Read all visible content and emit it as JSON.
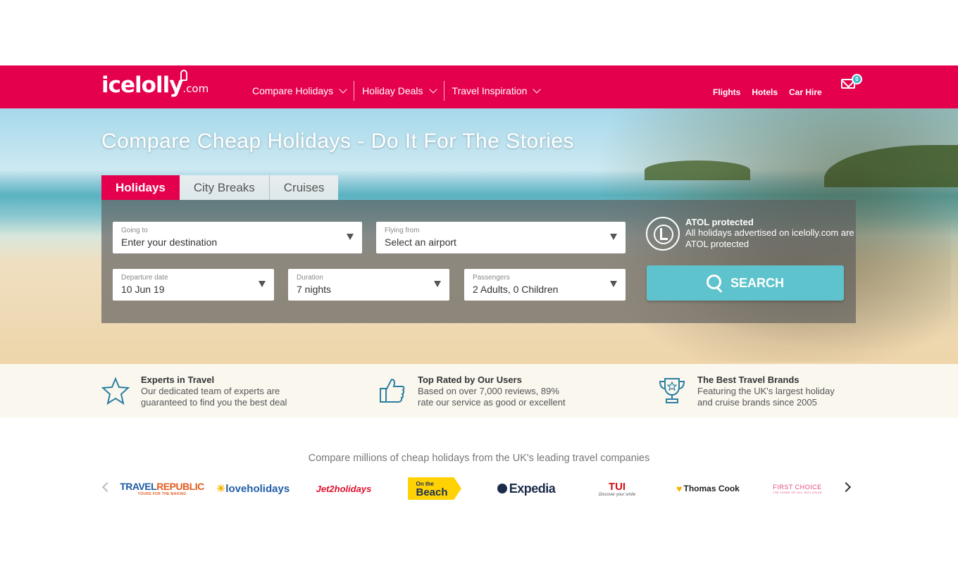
{
  "header": {
    "logo_main": "icelolly",
    "logo_suffix": ".com",
    "nav": [
      {
        "label": "Compare Holidays"
      },
      {
        "label": "Holiday Deals"
      },
      {
        "label": "Travel Inspiration"
      }
    ],
    "quick_links": [
      "Flights",
      "Hotels",
      "Car Hire"
    ],
    "mail_count": "0",
    "brand_color": "#e5004d"
  },
  "hero": {
    "title": "Compare Cheap Holidays - Do It For The Stories",
    "tabs": [
      "Holidays",
      "City Breaks",
      "Cruises"
    ],
    "active_tab": "Holidays"
  },
  "search": {
    "going_to": {
      "label": "Going to",
      "value": "Enter your destination"
    },
    "flying_from": {
      "label": "Flying from",
      "value": "Select an airport"
    },
    "departure": {
      "label": "Departure date",
      "value": "10 Jun 19"
    },
    "duration": {
      "label": "Duration",
      "value": "7 nights"
    },
    "passengers": {
      "label": "Passengers",
      "value": "2 Adults, 0 Children"
    },
    "button_label": "SEARCH",
    "button_color": "#5ec3cc",
    "atol_title": "ATOL protected",
    "atol_text": "All holidays advertised on icelolly.com are ATOL protected"
  },
  "features": [
    {
      "icon": "star-icon",
      "title": "Experts in Travel",
      "line1": "Our dedicated team of experts are",
      "line2": "guaranteed to find you the best deal"
    },
    {
      "icon": "thumbs-up-icon",
      "title": "Top Rated by Our Users",
      "line1": "Based on over 7,000 reviews, 89%",
      "line2": "rate our service as good or excellent"
    },
    {
      "icon": "trophy-icon",
      "title": "The Best Travel Brands",
      "line1": "Featuring the UK's largest holiday",
      "line2": "and cruise brands since 2005"
    }
  ],
  "brands": {
    "heading": "Compare millions of cheap holidays from the UK's leading travel companies",
    "items": [
      {
        "name": "TRAVELREPUBLIC",
        "part1": "TRAVEL",
        "part2": "REPUBLIC",
        "tagline": "YOURS FOR THE MAKING"
      },
      {
        "name": "loveholidays"
      },
      {
        "name": "Jet2holidays"
      },
      {
        "name": "On the Beach",
        "part1": "On the",
        "part2": "Beach"
      },
      {
        "name": "Expedia"
      },
      {
        "name": "TUI",
        "tagline": "Discover your smile"
      },
      {
        "name": "Thomas Cook"
      },
      {
        "name": "FIRST CHOICE",
        "tagline": "THE HOME OF ALL INCLUSIVE"
      }
    ]
  }
}
